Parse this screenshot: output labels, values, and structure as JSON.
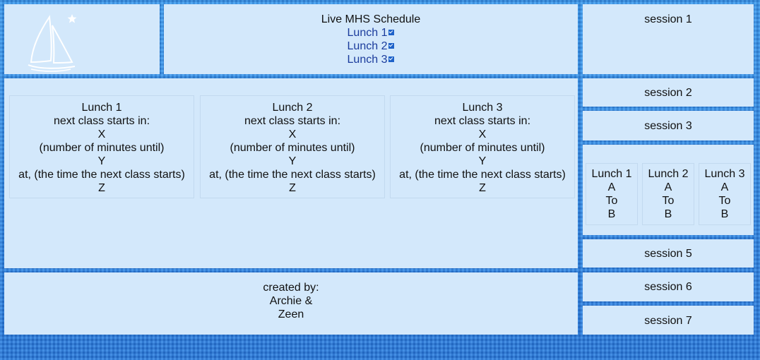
{
  "header": {
    "title": "Live MHS Schedule",
    "lunch_links": [
      "Lunch 1",
      "Lunch 2",
      "Lunch 3"
    ]
  },
  "lunches": [
    {
      "name": "Lunch 1",
      "line1": "next class starts in:",
      "x": "X",
      "x_desc": "(number of minutes until)",
      "y": "Y",
      "y_desc": "at, (the time the next class starts)",
      "z": "Z"
    },
    {
      "name": "Lunch 2",
      "line1": "next class starts in:",
      "x": "X",
      "x_desc": "(number of minutes until)",
      "y": "Y",
      "y_desc": "at, (the time the next class starts)",
      "z": "Z"
    },
    {
      "name": "Lunch 3",
      "line1": "next class starts in:",
      "x": "X",
      "x_desc": "(number of minutes until)",
      "y": "Y",
      "y_desc": "at, (the time the next class starts)",
      "z": "Z"
    }
  ],
  "sessions": {
    "s1": "session 1",
    "s2": "session 2",
    "s3": "session 3",
    "s5": "session 5",
    "s6": "session 6",
    "s7": "session 7"
  },
  "session4": [
    {
      "name": "Lunch 1",
      "from": "A",
      "to": "To",
      "end": "B"
    },
    {
      "name": "Lunch 2",
      "from": "A",
      "to": "To",
      "end": "B"
    },
    {
      "name": "Lunch 3",
      "from": "A",
      "to": "To",
      "end": "B"
    }
  ],
  "footer": {
    "line1": "created by:",
    "line2": "Archie &",
    "line3": "Zeen"
  },
  "colors": {
    "panel": "#d3e8fb",
    "border": "#2f8fe6",
    "link": "#1b3c9c"
  }
}
